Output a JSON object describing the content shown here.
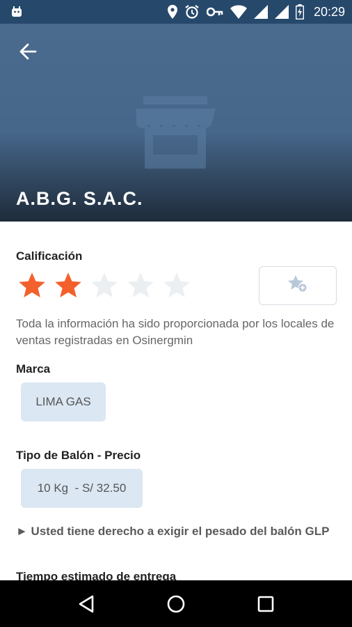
{
  "status_bar": {
    "time": "20:29",
    "icons": [
      "android-icon",
      "location-icon",
      "alarm-icon",
      "key-icon",
      "wifi-icon",
      "signal-icon",
      "signal-icon",
      "battery-charging-icon"
    ]
  },
  "header": {
    "title": "A.B.G. S.A.C.",
    "back_icon": "arrow-back-icon",
    "placeholder_icon": "store-icon",
    "bg_color": "#46668a"
  },
  "rating": {
    "label": "Calificación",
    "value": 2,
    "max": 5,
    "active_color": "#f4602c",
    "inactive_color": "#eceff2",
    "favorite_icon": "star-add-icon"
  },
  "info_text": "Toda la información ha sido proporcionada por los locales de ventas registradas en Osinergmin",
  "brand": {
    "label": "Marca",
    "value": "LIMA GAS"
  },
  "balloon": {
    "label": "Tipo de Balón - Precio",
    "value": "10 Kg  - S/ 32.50"
  },
  "notice": "► Usted tiene derecho a exigir el pesado del balón GLP",
  "eta": {
    "label": "Tiempo estimado de entrega"
  },
  "nav": {
    "back_icon": "triangle-back-icon",
    "home_icon": "circle-home-icon",
    "recents_icon": "square-recents-icon"
  }
}
